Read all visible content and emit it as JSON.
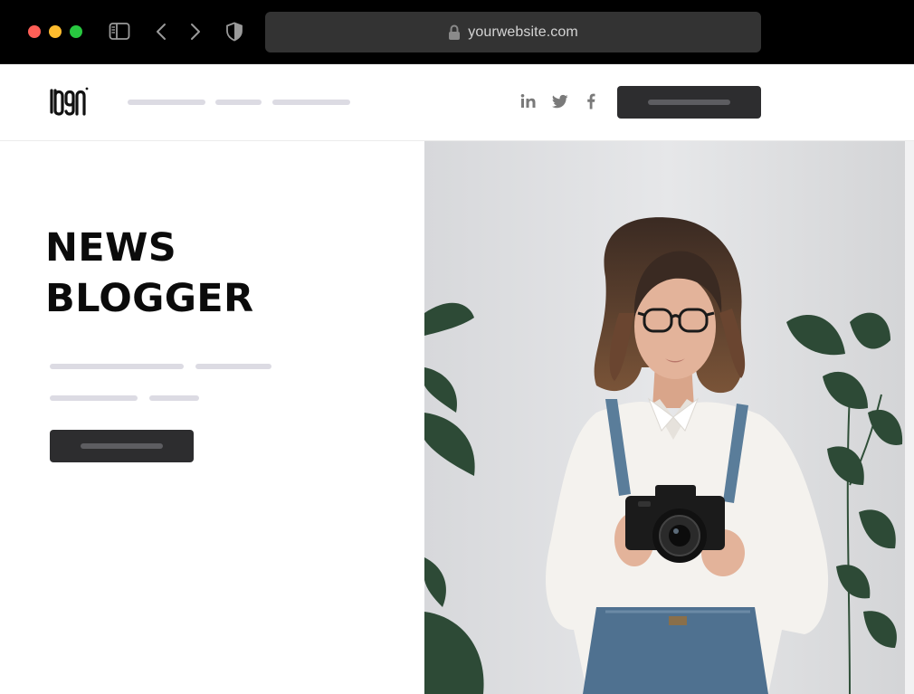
{
  "browser": {
    "url": "yourwebsite.com",
    "icons": [
      "sidebar-icon",
      "chevron-left-icon",
      "chevron-right-icon",
      "shield-icon",
      "lock-icon"
    ]
  },
  "nav": {
    "logo_icon": "logo-icon",
    "social_icons": [
      "linkedin-icon",
      "twitter-icon",
      "facebook-icon"
    ]
  },
  "hero": {
    "title_line1": "NEWS",
    "title_line2": "BLOGGER",
    "photo": "woman-with-camera-photo"
  },
  "colors": {
    "chrome_bg": "#000000",
    "urlbar_bg": "#333333",
    "button_dark": "#2d2d2f",
    "placeholder_line": "#dcdbe3",
    "title_text": "#0b0b0b"
  }
}
